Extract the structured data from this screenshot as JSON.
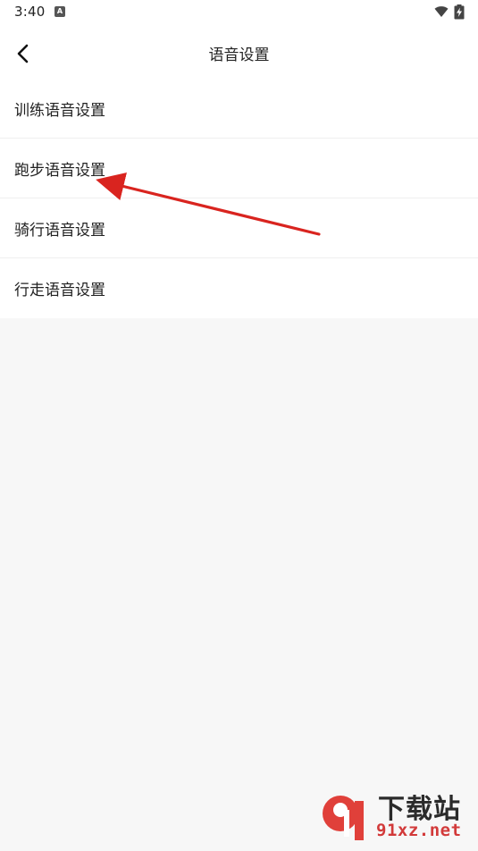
{
  "status_bar": {
    "time": "3:40",
    "app_icon_letter": "A",
    "wifi_icon": "wifi-icon",
    "battery_icon": "battery-charging-icon"
  },
  "app_bar": {
    "back_icon": "chevron-left-icon",
    "title": "语音设置"
  },
  "menu": {
    "items": [
      {
        "label": "训练语音设置"
      },
      {
        "label": "跑步语音设置"
      },
      {
        "label": "骑行语音设置"
      },
      {
        "label": "行走语音设置"
      }
    ]
  },
  "annotation": {
    "arrow_color": "#d9241f"
  },
  "watermark": {
    "title": "下载站",
    "domain": "91xz.net",
    "logo_color": "#e0403a"
  },
  "colors": {
    "background": "#f7f7f7",
    "surface": "#ffffff",
    "text": "#222222",
    "divider": "#efefef"
  }
}
